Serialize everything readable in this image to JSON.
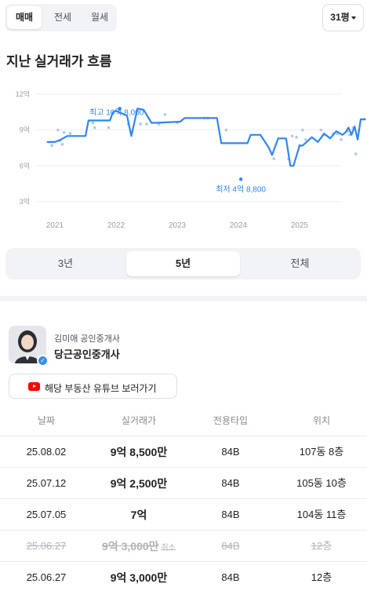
{
  "trade_tabs": [
    {
      "label": "매매",
      "active": true
    },
    {
      "label": "전세",
      "active": false
    },
    {
      "label": "월세",
      "active": false
    }
  ],
  "area_select": {
    "label": "31평"
  },
  "section_title": "지난 실거래가 흐름",
  "chart_data": {
    "type": "line",
    "title": "",
    "xlabel": "",
    "ylabel": "",
    "y_ticks": [
      "12억",
      "9억",
      "6억",
      "3억"
    ],
    "y_tick_values": [
      12,
      9,
      6,
      3
    ],
    "x_ticks": [
      "2021",
      "2022",
      "2023",
      "2024",
      "2025"
    ],
    "x_tick_values": [
      2021,
      2022,
      2023,
      2024,
      2025
    ],
    "ylim": [
      3,
      12
    ],
    "grid": true,
    "line_color": "#2e86f5",
    "dot_color": "#a9c9f2",
    "series": [
      {
        "x": [
          2020.88,
          2021.0,
          2021.1,
          2021.2,
          2021.3,
          2021.5,
          2021.55,
          2021.72,
          2021.9,
          2021.95,
          2022.0,
          2022.18,
          2022.25,
          2022.35,
          2022.45,
          2022.58,
          2022.65,
          2023.05,
          2023.12,
          2023.4,
          2023.45,
          2023.65,
          2023.72,
          2023.85,
          2024.15,
          2024.2,
          2024.3,
          2024.36,
          2024.5,
          2024.55,
          2024.65,
          2024.72,
          2024.78,
          2024.85,
          2024.9,
          2025.0,
          2025.05,
          2025.2,
          2025.3,
          2025.4,
          2025.5,
          2025.6,
          2025.7,
          2025.75,
          2025.8,
          2025.85,
          2025.9,
          2025.95,
          2026.0,
          2026.07
        ],
        "y": [
          8.0,
          8.0,
          8.2,
          8.5,
          8.5,
          8.5,
          9.8,
          9.8,
          9.8,
          10.5,
          10.6,
          10.2,
          8.5,
          10.8,
          10.7,
          9.6,
          9.6,
          9.7,
          10.0,
          10.0,
          10.0,
          10.0,
          7.9,
          7.9,
          7.9,
          8.6,
          8.6,
          8.6,
          7.5,
          6.9,
          8.3,
          8.3,
          8.3,
          6.0,
          6.0,
          7.7,
          7.7,
          8.4,
          8.0,
          8.7,
          8.3,
          8.9,
          8.6,
          8.8,
          9.2,
          8.6,
          9.3,
          8.2,
          9.9,
          9.9
        ]
      }
    ],
    "scatter": {
      "x": [
        2020.95,
        2021.05,
        2021.15,
        2021.25,
        2021.12,
        2021.08,
        2021.62,
        2021.65,
        2021.88,
        2022.2,
        2022.4,
        2022.5,
        2022.7,
        2022.8,
        2023.0,
        2023.45,
        2023.5,
        2023.8,
        2024.58,
        2024.82,
        2024.88,
        2024.95,
        2025.0,
        2025.05,
        2025.1,
        2025.35,
        2025.4,
        2025.55,
        2025.62,
        2025.68,
        2025.78,
        2025.82,
        2025.88,
        2025.92,
        2025.97,
        2026.05
      ],
      "y": [
        7.7,
        9.0,
        8.8,
        8.7,
        7.8,
        8.1,
        9.6,
        9.2,
        9.2,
        9.5,
        9.5,
        9.5,
        9.5,
        10.3,
        9.6,
        10.0,
        10.0,
        9.0,
        6.6,
        6.6,
        8.5,
        8.4,
        7.7,
        9.0,
        8.2,
        9.0,
        8.6,
        8.7,
        8.7,
        8.2,
        8.9,
        8.6,
        9.2,
        7.0,
        9.0,
        9.9
      ]
    },
    "annotations": [
      {
        "label": "최고 10억 8,000",
        "x": 2022.06,
        "y": 10.8
      },
      {
        "label": "최저 4억 8,800",
        "x": 2024.04,
        "y": 4.88
      }
    ]
  },
  "period_tabs": [
    {
      "label": "3년",
      "active": false
    },
    {
      "label": "5년",
      "active": true
    },
    {
      "label": "전체",
      "active": false
    }
  ],
  "agent": {
    "name": "김미애 공인중개사",
    "agency": "당근공인중개사",
    "verified_icon": "check-icon"
  },
  "youtube_button": {
    "label": "해당 부동산 유튜브 보러가기",
    "icon": "youtube-icon"
  },
  "deal_table": {
    "headers": [
      "날짜",
      "실거래가",
      "전용타입",
      "위치"
    ],
    "rows": [
      {
        "date": "25.08.02",
        "price": "9억 8,500만",
        "type": "84B",
        "location": "107동 8층",
        "cancelled": false,
        "cancel_label": ""
      },
      {
        "date": "25.07.12",
        "price": "9억 2,500만",
        "type": "84B",
        "location": "105동 10층",
        "cancelled": false,
        "cancel_label": ""
      },
      {
        "date": "25.07.05",
        "price": "7억",
        "type": "84B",
        "location": "104동 11층",
        "cancelled": false,
        "cancel_label": ""
      },
      {
        "date": "25.06.27",
        "price": "9억 3,000만",
        "type": "84B",
        "location": "12층",
        "cancelled": true,
        "cancel_label": "취소"
      },
      {
        "date": "25.06.27",
        "price": "9억 3,000만",
        "type": "84B",
        "location": "12층",
        "cancelled": false,
        "cancel_label": ""
      }
    ]
  }
}
